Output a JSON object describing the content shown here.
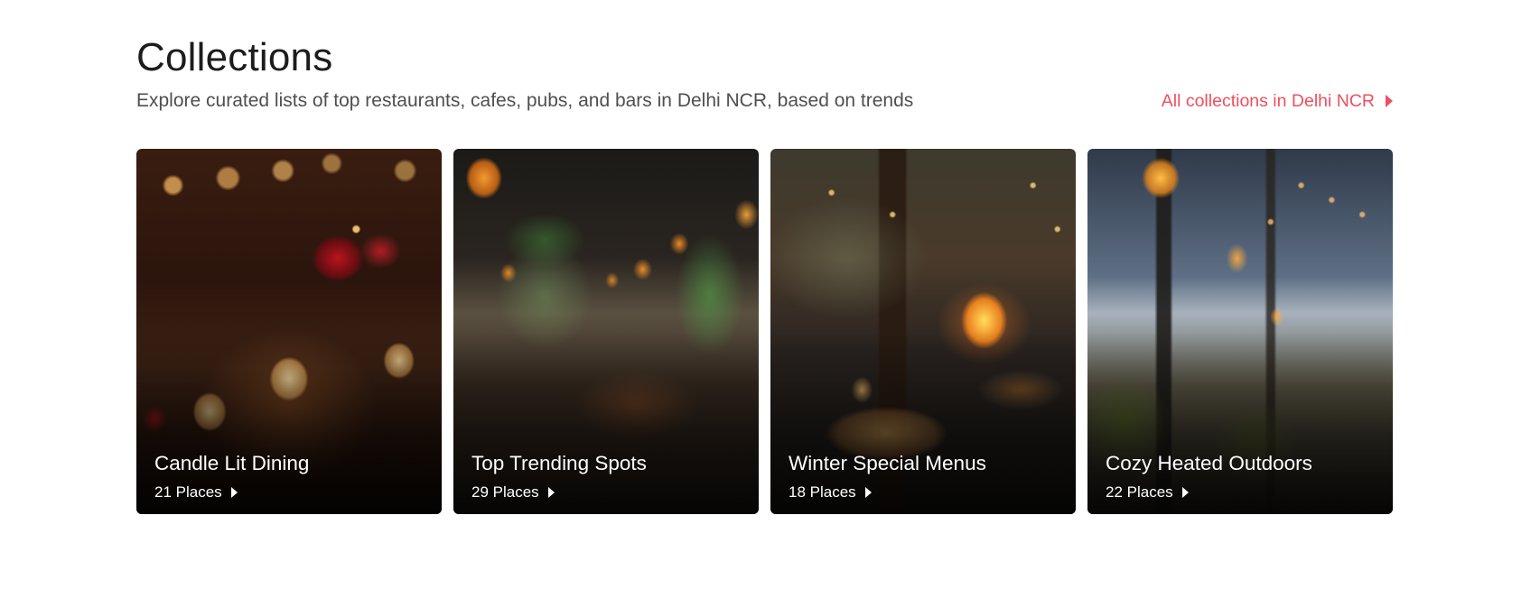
{
  "header": {
    "title": "Collections",
    "subtitle": "Explore curated lists of top restaurants, cafes, pubs, and bars in Delhi NCR, based on trends",
    "all_link_label": "All collections in Delhi NCR",
    "link_color": "#ef4f5f"
  },
  "collections": [
    {
      "title": "Candle Lit Dining",
      "places": "21 Places",
      "image": "candle-lit-dining-photo"
    },
    {
      "title": "Top Trending Spots",
      "places": "29 Places",
      "image": "trending-restaurant-interior-photo"
    },
    {
      "title": "Winter Special Menus",
      "places": "18 Places",
      "image": "winter-dinner-fireplace-photo"
    },
    {
      "title": "Cozy Heated Outdoors",
      "places": "22 Places",
      "image": "outdoor-patio-heater-photo"
    }
  ]
}
